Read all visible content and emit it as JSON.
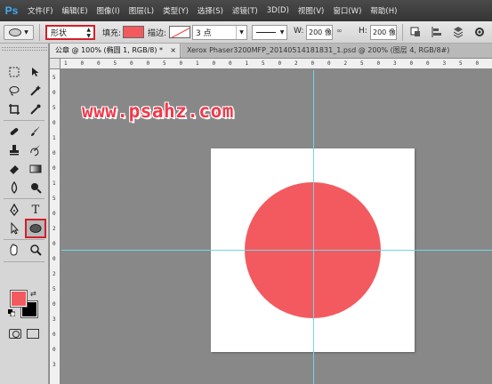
{
  "app": {
    "logo": "Ps"
  },
  "menu": [
    "文件(F)",
    "编辑(E)",
    "图像(I)",
    "图层(L)",
    "类型(Y)",
    "选择(S)",
    "滤镜(T)",
    "3D(D)",
    "视图(V)",
    "窗口(W)",
    "帮助(H)"
  ],
  "options": {
    "mode_value": "形状",
    "fill_label": "填充:",
    "fill_color": "#f25a5f",
    "stroke_label": "描边:",
    "stroke_width": "3 点",
    "w_label": "W:",
    "w_value": "200 像",
    "h_label": "H:",
    "h_value": "200 像"
  },
  "tabs": [
    {
      "label": "公章 @ 100% (椭圆 1, RGB/8) *",
      "close": "×"
    },
    {
      "label": "Xerox Phaser3200MFP_20140514181831_1.psd @ 200% (图层 4, RGB/8#)",
      "close": "×"
    }
  ],
  "ruler": {
    "top_ticks": [
      "1",
      "0",
      "0",
      "5",
      "0",
      "0",
      "5",
      "0",
      "1",
      "0",
      "0",
      "1",
      "5",
      "0",
      "2",
      "0",
      "0",
      "2",
      "5",
      "0",
      "3",
      "0",
      "0",
      "3",
      "5",
      "0"
    ],
    "left_ticks": [
      "5",
      "0",
      "5",
      "0",
      "1",
      "0",
      "0",
      "1",
      "5",
      "0",
      "2",
      "0",
      "0",
      "2",
      "5",
      "0",
      "3",
      "0",
      "0",
      "3"
    ]
  },
  "canvas": {
    "watermark": "www.psahz.com",
    "shape_color": "#f25a5f",
    "guide_color": "#6fd8e8"
  },
  "colors": {
    "foreground": "#f25a5f",
    "background": "#000000"
  }
}
